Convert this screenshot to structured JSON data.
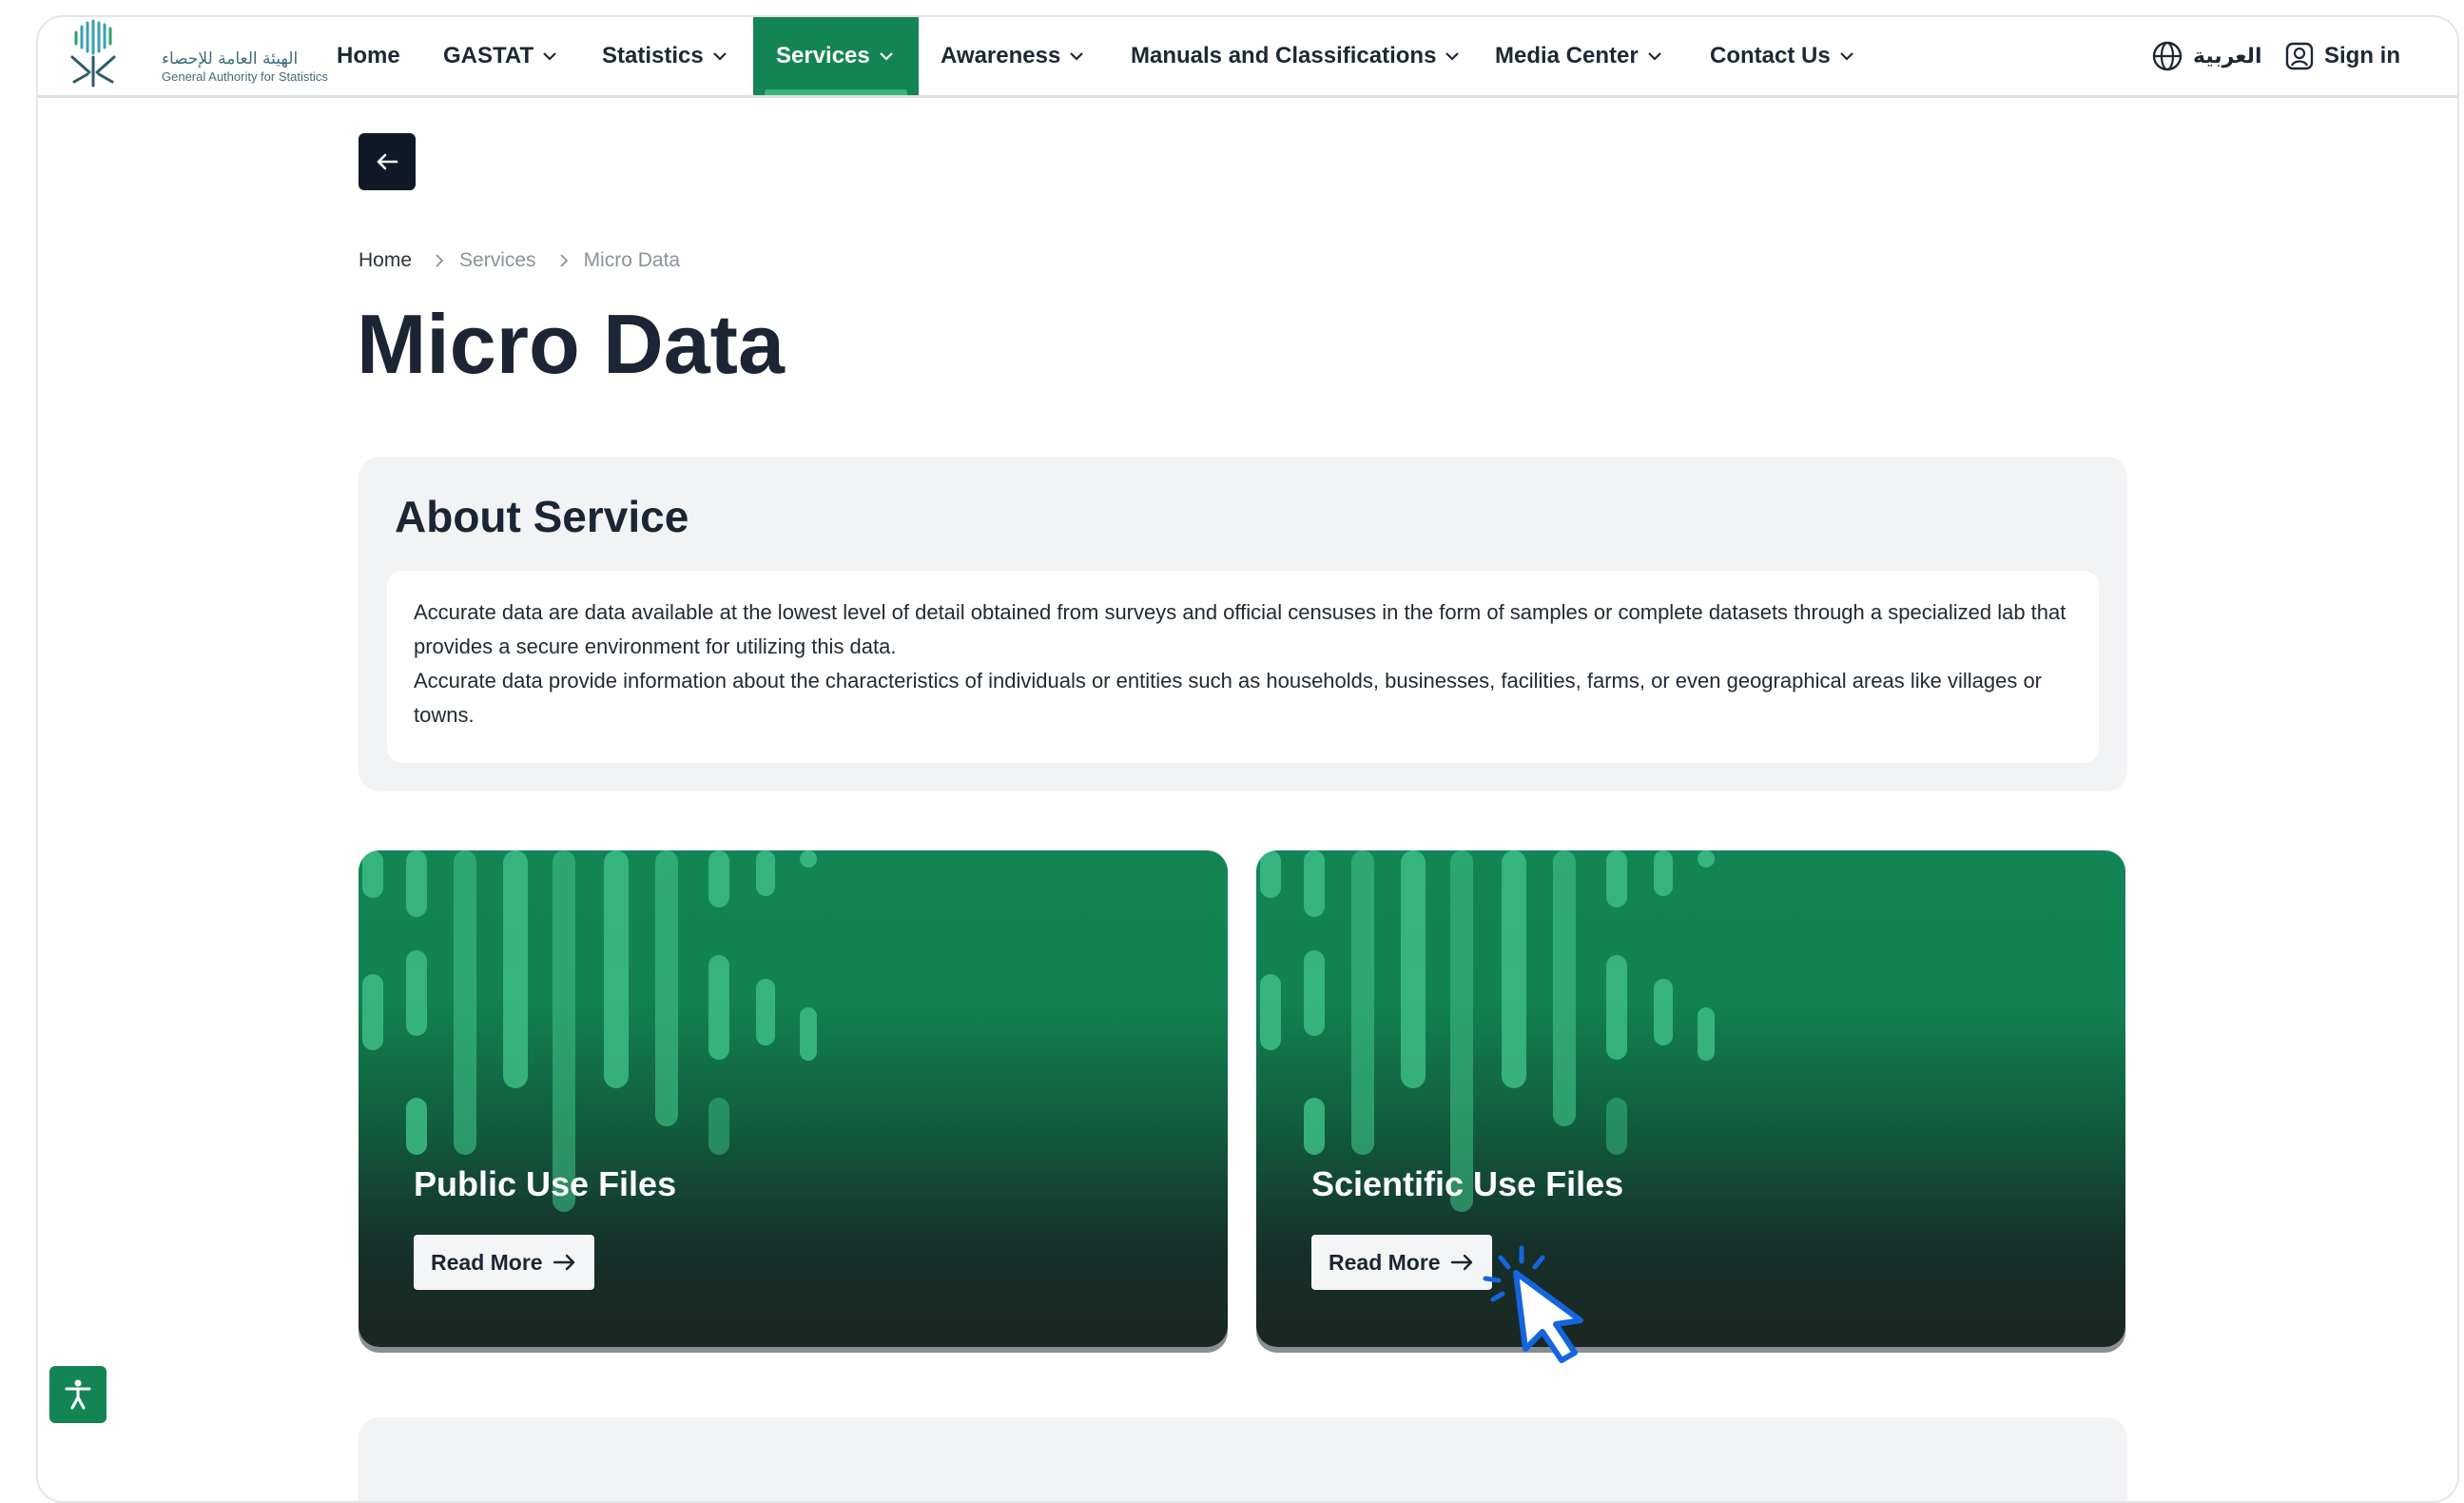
{
  "header": {
    "logo_arabic": "الهيئة العامة للإحصاء",
    "logo_english": "General Authority for Statistics",
    "nav": [
      {
        "label": "Home"
      },
      {
        "label": "GASTAT"
      },
      {
        "label": "Statistics"
      },
      {
        "label": "Services"
      },
      {
        "label": "Awareness"
      },
      {
        "label": "Manuals and Classifications"
      },
      {
        "label": "Media Center"
      },
      {
        "label": "Contact Us"
      }
    ],
    "active_nav": "Services",
    "language_label": "العربية",
    "signin_label": "Sign in"
  },
  "breadcrumb": [
    "Home",
    "Services",
    "Micro Data"
  ],
  "page_title": "Micro Data",
  "about": {
    "title": "About Service",
    "paragraph_1": "Accurate data are data available at the lowest level of detail obtained from surveys and official censuses in the form of samples or complete datasets through a specialized lab that provides a secure environment for utilizing this data.",
    "paragraph_2": "Accurate data provide information about the characteristics of individuals or entities such as households, businesses, facilities, farms, or even geographical areas like villages or towns."
  },
  "cards": [
    {
      "title": "Public Use Files",
      "button": "Read More"
    },
    {
      "title": "Scientific Use Files",
      "button": "Read More"
    }
  ],
  "icons": {
    "back": "arrow-left-icon",
    "globe": "globe-icon",
    "user": "user-icon",
    "accessibility": "accessibility-icon",
    "arrow_right": "arrow-right-icon",
    "chevron": "chevron-down-icon"
  },
  "colors": {
    "brand_green": "#138554",
    "accent_green": "#36b57c",
    "dark": "#111827"
  }
}
